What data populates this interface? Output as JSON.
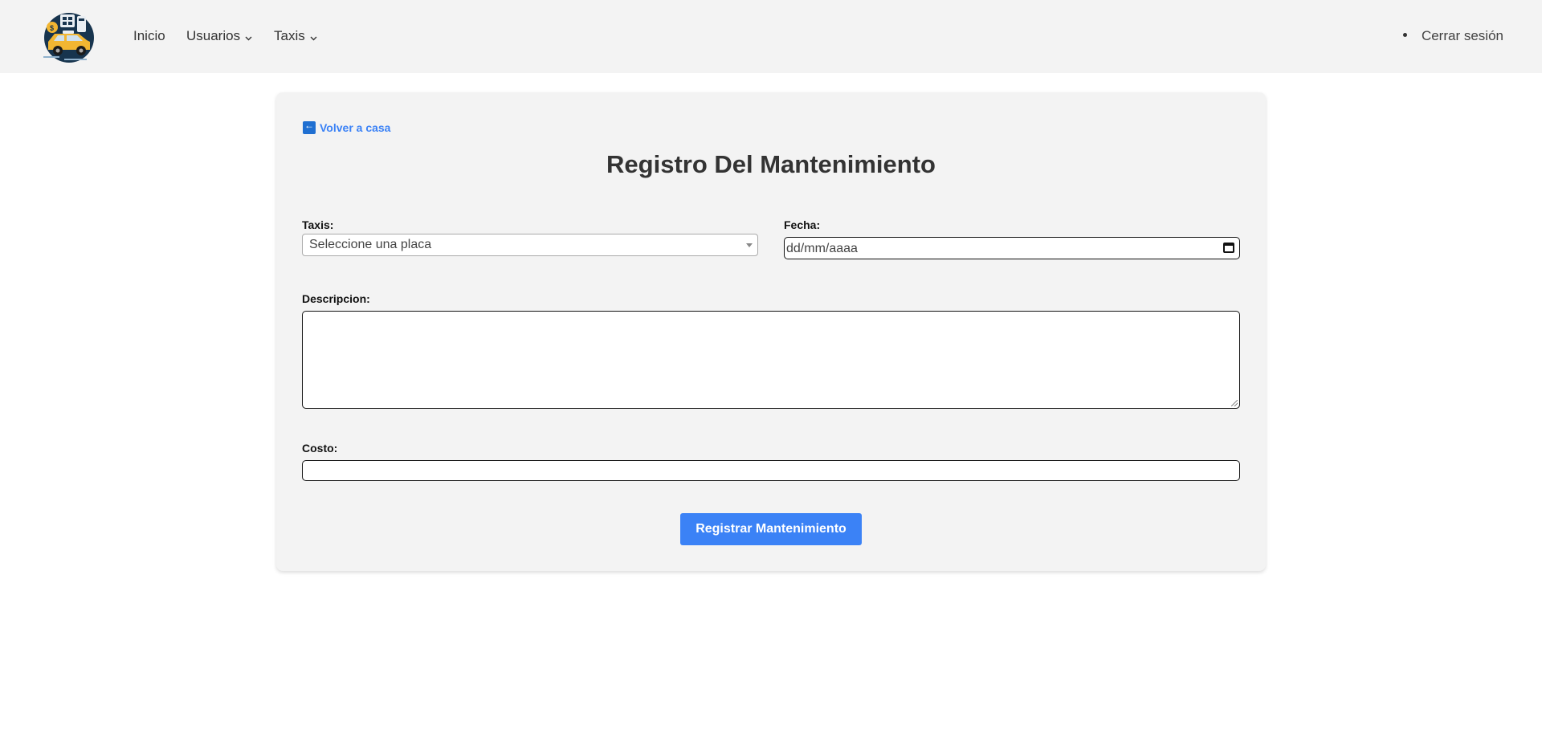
{
  "nav": {
    "items": [
      {
        "label": "Inicio",
        "has_dropdown": false
      },
      {
        "label": "Usuarios",
        "has_dropdown": true
      },
      {
        "label": "Taxis",
        "has_dropdown": true
      }
    ],
    "logout_label": "Cerrar sesión"
  },
  "card": {
    "back_label": "Volver a casa",
    "title": "Registro Del Mantenimiento",
    "fields": {
      "taxis_label": "Taxis:",
      "taxis_placeholder": "Seleccione una placa",
      "fecha_label": "Fecha:",
      "fecha_placeholder": "dd/mm/aaaa",
      "descripcion_label": "Descripcion:",
      "descripcion_value": "",
      "costo_label": "Costo:",
      "costo_value": ""
    },
    "submit_label": "Registrar Mantenimiento"
  },
  "colors": {
    "accent": "#3b82f6",
    "header_bg": "#f3f3f3",
    "card_bg": "#f3f3f3",
    "logo_bg": "#17344e",
    "taxi_yellow": "#f2b632"
  }
}
